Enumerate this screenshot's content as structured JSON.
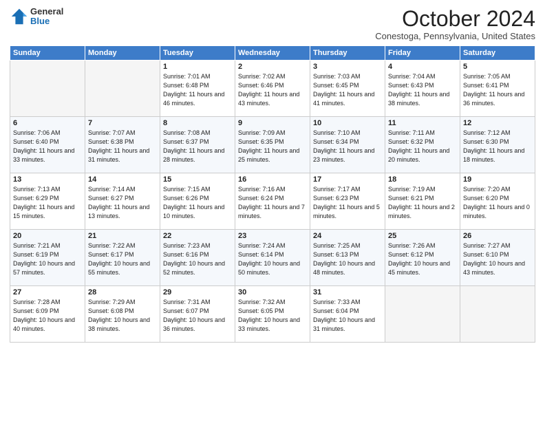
{
  "header": {
    "logo": {
      "general": "General",
      "blue": "Blue"
    },
    "month": "October 2024",
    "location": "Conestoga, Pennsylvania, United States"
  },
  "weekdays": [
    "Sunday",
    "Monday",
    "Tuesday",
    "Wednesday",
    "Thursday",
    "Friday",
    "Saturday"
  ],
  "weeks": [
    [
      {
        "day": "",
        "info": ""
      },
      {
        "day": "",
        "info": ""
      },
      {
        "day": "1",
        "info": "Sunrise: 7:01 AM\nSunset: 6:48 PM\nDaylight: 11 hours and 46 minutes."
      },
      {
        "day": "2",
        "info": "Sunrise: 7:02 AM\nSunset: 6:46 PM\nDaylight: 11 hours and 43 minutes."
      },
      {
        "day": "3",
        "info": "Sunrise: 7:03 AM\nSunset: 6:45 PM\nDaylight: 11 hours and 41 minutes."
      },
      {
        "day": "4",
        "info": "Sunrise: 7:04 AM\nSunset: 6:43 PM\nDaylight: 11 hours and 38 minutes."
      },
      {
        "day": "5",
        "info": "Sunrise: 7:05 AM\nSunset: 6:41 PM\nDaylight: 11 hours and 36 minutes."
      }
    ],
    [
      {
        "day": "6",
        "info": "Sunrise: 7:06 AM\nSunset: 6:40 PM\nDaylight: 11 hours and 33 minutes."
      },
      {
        "day": "7",
        "info": "Sunrise: 7:07 AM\nSunset: 6:38 PM\nDaylight: 11 hours and 31 minutes."
      },
      {
        "day": "8",
        "info": "Sunrise: 7:08 AM\nSunset: 6:37 PM\nDaylight: 11 hours and 28 minutes."
      },
      {
        "day": "9",
        "info": "Sunrise: 7:09 AM\nSunset: 6:35 PM\nDaylight: 11 hours and 25 minutes."
      },
      {
        "day": "10",
        "info": "Sunrise: 7:10 AM\nSunset: 6:34 PM\nDaylight: 11 hours and 23 minutes."
      },
      {
        "day": "11",
        "info": "Sunrise: 7:11 AM\nSunset: 6:32 PM\nDaylight: 11 hours and 20 minutes."
      },
      {
        "day": "12",
        "info": "Sunrise: 7:12 AM\nSunset: 6:30 PM\nDaylight: 11 hours and 18 minutes."
      }
    ],
    [
      {
        "day": "13",
        "info": "Sunrise: 7:13 AM\nSunset: 6:29 PM\nDaylight: 11 hours and 15 minutes."
      },
      {
        "day": "14",
        "info": "Sunrise: 7:14 AM\nSunset: 6:27 PM\nDaylight: 11 hours and 13 minutes."
      },
      {
        "day": "15",
        "info": "Sunrise: 7:15 AM\nSunset: 6:26 PM\nDaylight: 11 hours and 10 minutes."
      },
      {
        "day": "16",
        "info": "Sunrise: 7:16 AM\nSunset: 6:24 PM\nDaylight: 11 hours and 7 minutes."
      },
      {
        "day": "17",
        "info": "Sunrise: 7:17 AM\nSunset: 6:23 PM\nDaylight: 11 hours and 5 minutes."
      },
      {
        "day": "18",
        "info": "Sunrise: 7:19 AM\nSunset: 6:21 PM\nDaylight: 11 hours and 2 minutes."
      },
      {
        "day": "19",
        "info": "Sunrise: 7:20 AM\nSunset: 6:20 PM\nDaylight: 11 hours and 0 minutes."
      }
    ],
    [
      {
        "day": "20",
        "info": "Sunrise: 7:21 AM\nSunset: 6:19 PM\nDaylight: 10 hours and 57 minutes."
      },
      {
        "day": "21",
        "info": "Sunrise: 7:22 AM\nSunset: 6:17 PM\nDaylight: 10 hours and 55 minutes."
      },
      {
        "day": "22",
        "info": "Sunrise: 7:23 AM\nSunset: 6:16 PM\nDaylight: 10 hours and 52 minutes."
      },
      {
        "day": "23",
        "info": "Sunrise: 7:24 AM\nSunset: 6:14 PM\nDaylight: 10 hours and 50 minutes."
      },
      {
        "day": "24",
        "info": "Sunrise: 7:25 AM\nSunset: 6:13 PM\nDaylight: 10 hours and 48 minutes."
      },
      {
        "day": "25",
        "info": "Sunrise: 7:26 AM\nSunset: 6:12 PM\nDaylight: 10 hours and 45 minutes."
      },
      {
        "day": "26",
        "info": "Sunrise: 7:27 AM\nSunset: 6:10 PM\nDaylight: 10 hours and 43 minutes."
      }
    ],
    [
      {
        "day": "27",
        "info": "Sunrise: 7:28 AM\nSunset: 6:09 PM\nDaylight: 10 hours and 40 minutes."
      },
      {
        "day": "28",
        "info": "Sunrise: 7:29 AM\nSunset: 6:08 PM\nDaylight: 10 hours and 38 minutes."
      },
      {
        "day": "29",
        "info": "Sunrise: 7:31 AM\nSunset: 6:07 PM\nDaylight: 10 hours and 36 minutes."
      },
      {
        "day": "30",
        "info": "Sunrise: 7:32 AM\nSunset: 6:05 PM\nDaylight: 10 hours and 33 minutes."
      },
      {
        "day": "31",
        "info": "Sunrise: 7:33 AM\nSunset: 6:04 PM\nDaylight: 10 hours and 31 minutes."
      },
      {
        "day": "",
        "info": ""
      },
      {
        "day": "",
        "info": ""
      }
    ]
  ]
}
